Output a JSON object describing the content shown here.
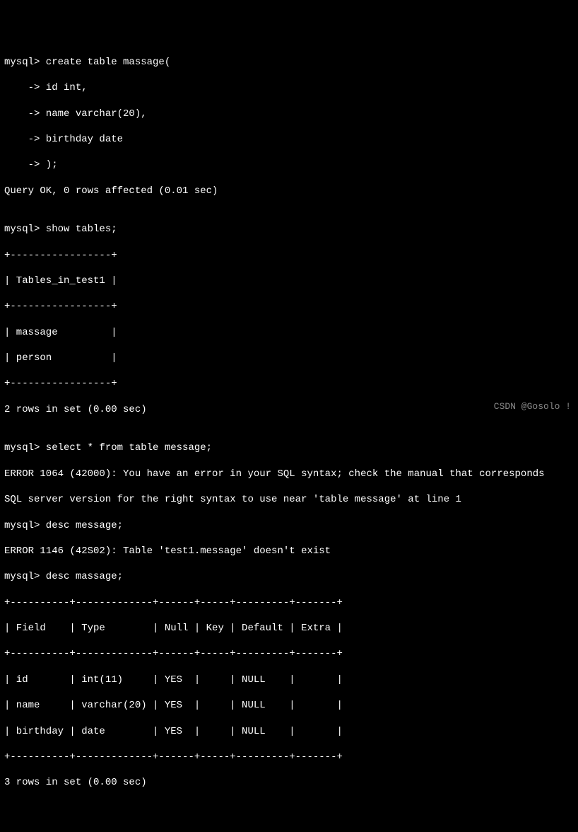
{
  "lines": {
    "l0": "mysql> create table massage(",
    "l1": "    -> id int,",
    "l2": "    -> name varchar(20),",
    "l3": "    -> birthday date",
    "l4": "    -> );",
    "l5": "Query OK, 0 rows affected (0.01 sec)",
    "l6": "",
    "l7": "mysql> show tables;",
    "l8": "+-----------------+",
    "l9": "| Tables_in_test1 |",
    "l10": "+-----------------+",
    "l11": "| massage         |",
    "l12": "| person          |",
    "l13": "+-----------------+",
    "l14": "2 rows in set (0.00 sec)",
    "l15": "",
    "l16": "mysql> select * from table message;",
    "l17": "ERROR 1064 (42000): You have an error in your SQL syntax; check the manual that corresponds",
    "l18": "SQL server version for the right syntax to use near 'table message' at line 1",
    "l19": "mysql> desc message;",
    "l20": "ERROR 1146 (42S02): Table 'test1.message' doesn't exist",
    "l21": "mysql> desc massage;",
    "l22": "+----------+-------------+------+-----+---------+-------+",
    "l23": "| Field    | Type        | Null | Key | Default | Extra |",
    "l24": "+----------+-------------+------+-----+---------+-------+",
    "l25": "| id       | int(11)     | YES  |     | NULL    |       |",
    "l26": "| name     | varchar(20) | YES  |     | NULL    |       |",
    "l27": "| birthday | date        | YES  |     | NULL    |       |",
    "l28": "+----------+-------------+------+-----+---------+-------+",
    "l29": "3 rows in set (0.00 sec)"
  },
  "watermark": "CSDN @Gosolo !"
}
